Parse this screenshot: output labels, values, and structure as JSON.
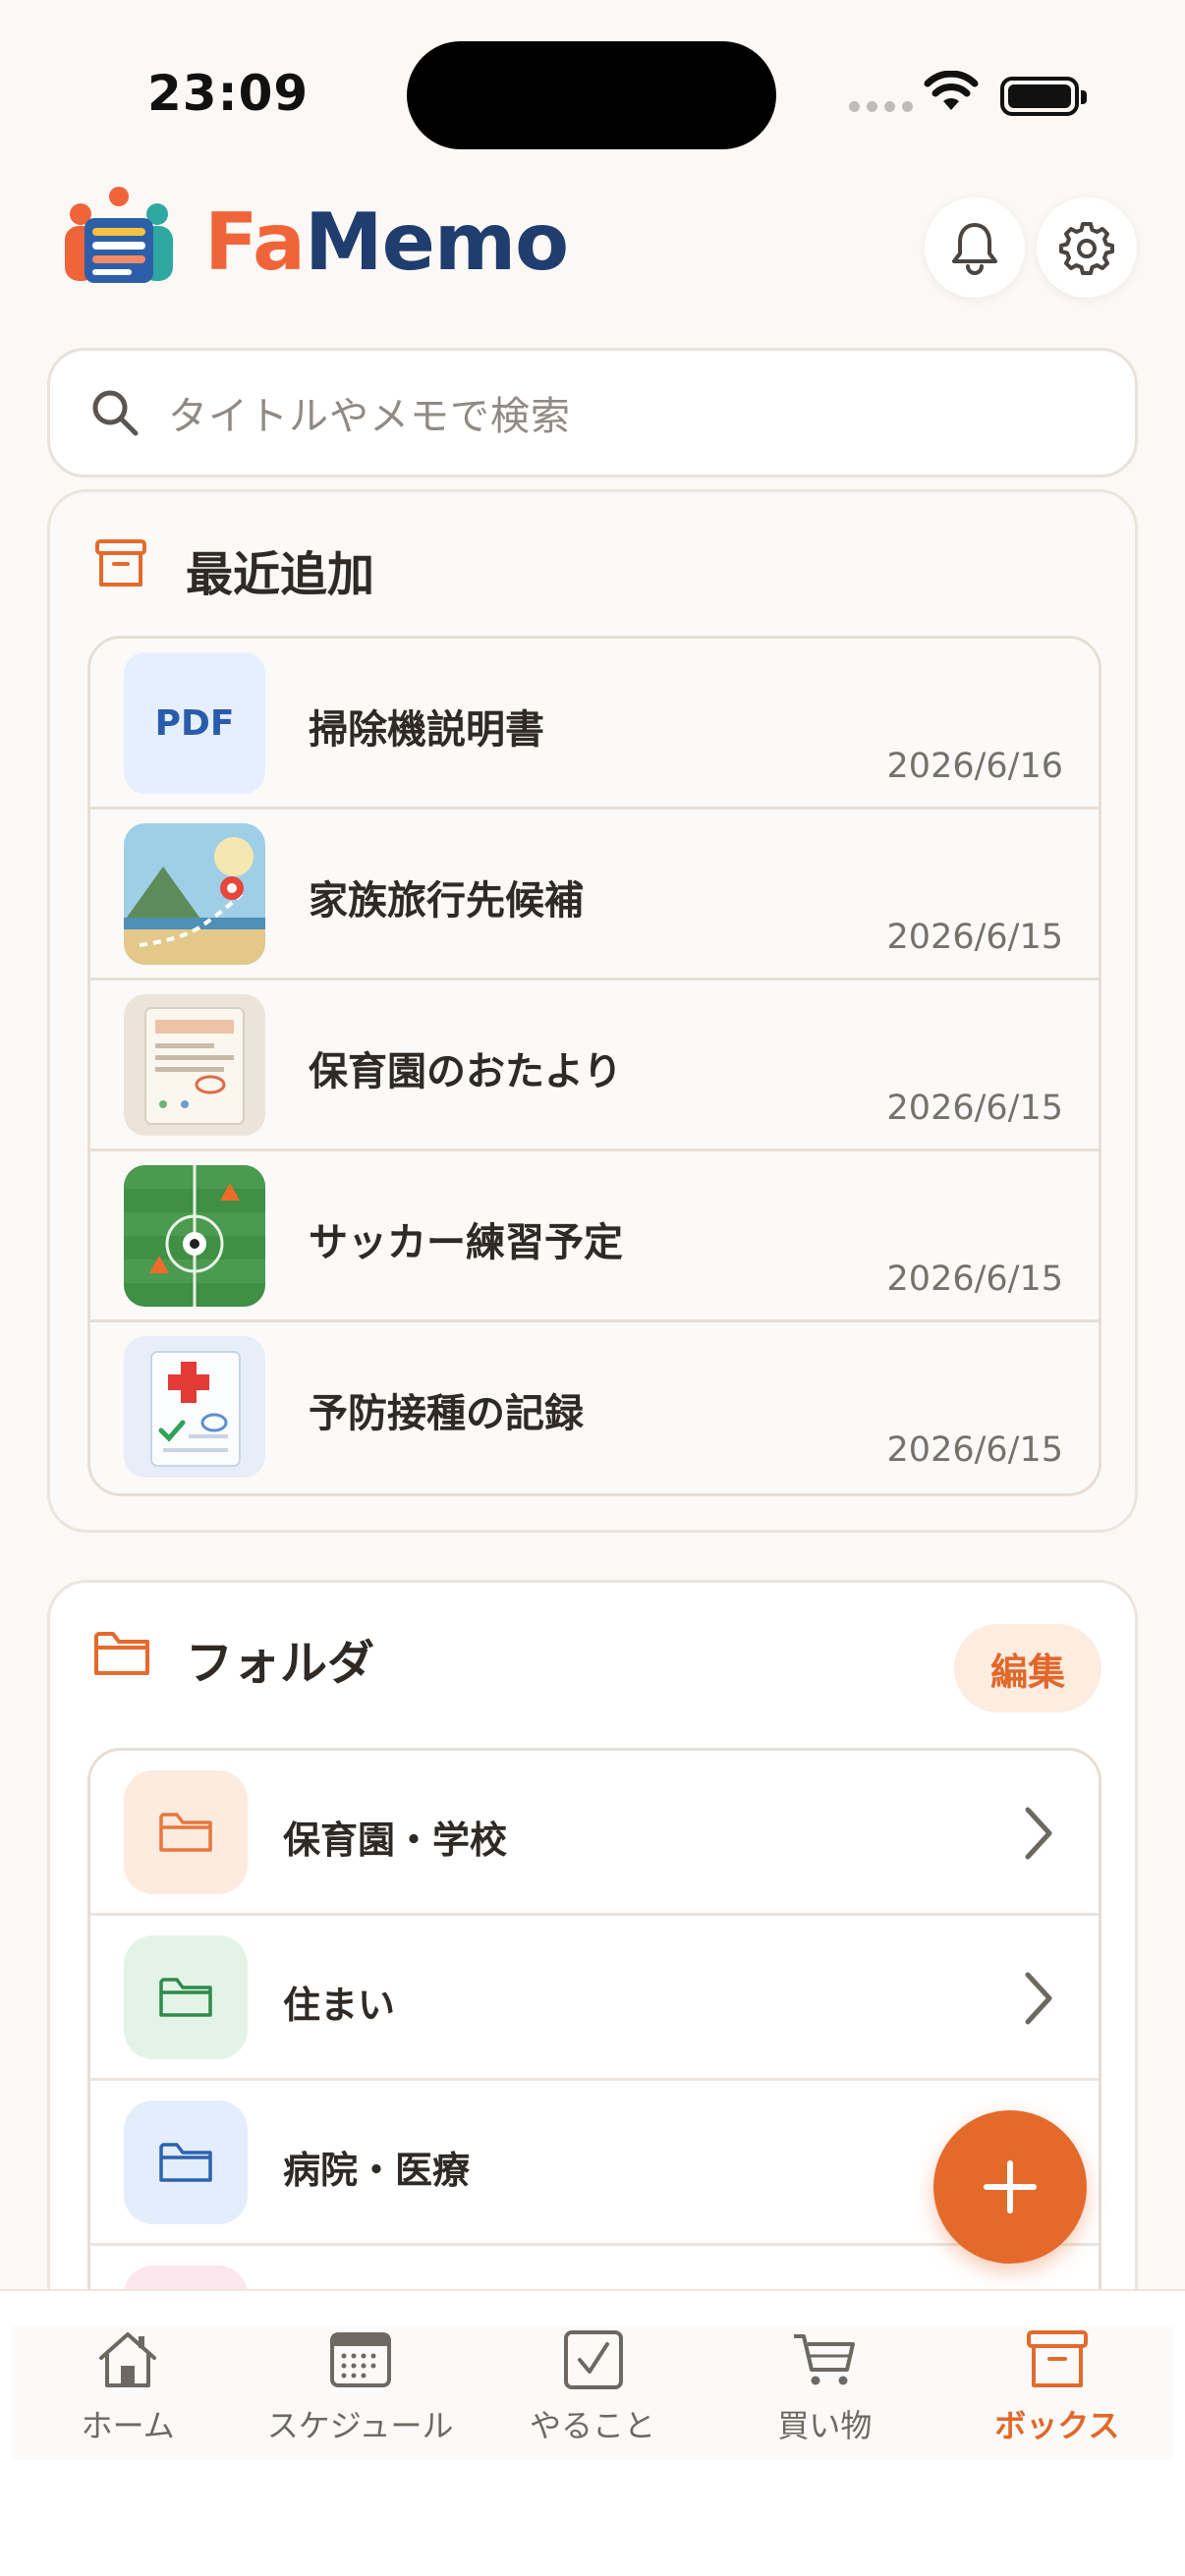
{
  "status": {
    "time": "23:09"
  },
  "app": {
    "name_part1": "Fa",
    "name_part2": "Memo"
  },
  "search": {
    "placeholder": "タイトルやメモで検索"
  },
  "recent": {
    "title": "最近追加",
    "items": [
      {
        "name": "掃除機説明書",
        "date": "2026/6/16",
        "thumb": "PDF"
      },
      {
        "name": "家族旅行先候補",
        "date": "2026/6/15"
      },
      {
        "name": "保育園のおたより",
        "date": "2026/6/15"
      },
      {
        "name": "サッカー練習予定",
        "date": "2026/6/15"
      },
      {
        "name": "予防接種の記録",
        "date": "2026/6/15"
      }
    ]
  },
  "folders": {
    "title": "フォルダ",
    "edit_label": "編集",
    "items": [
      {
        "name": "保育園・学校",
        "color": "#e8763a",
        "bg": "#fdebe0"
      },
      {
        "name": "住まい",
        "color": "#2f8a4a",
        "bg": "#e3f4e6"
      },
      {
        "name": "病院・医療",
        "color": "#2d62b0",
        "bg": "#e4edfb"
      }
    ]
  },
  "tabs": [
    {
      "label": "ホーム",
      "icon": "home-icon"
    },
    {
      "label": "スケジュール",
      "icon": "calendar-icon"
    },
    {
      "label": "やること",
      "icon": "checkbox-icon"
    },
    {
      "label": "買い物",
      "icon": "cart-icon"
    },
    {
      "label": "ボックス",
      "icon": "box-icon",
      "active": true
    }
  ],
  "colors": {
    "accent": "#e46a2c",
    "navy": "#1f3d6e",
    "background": "#fbf8f5"
  }
}
